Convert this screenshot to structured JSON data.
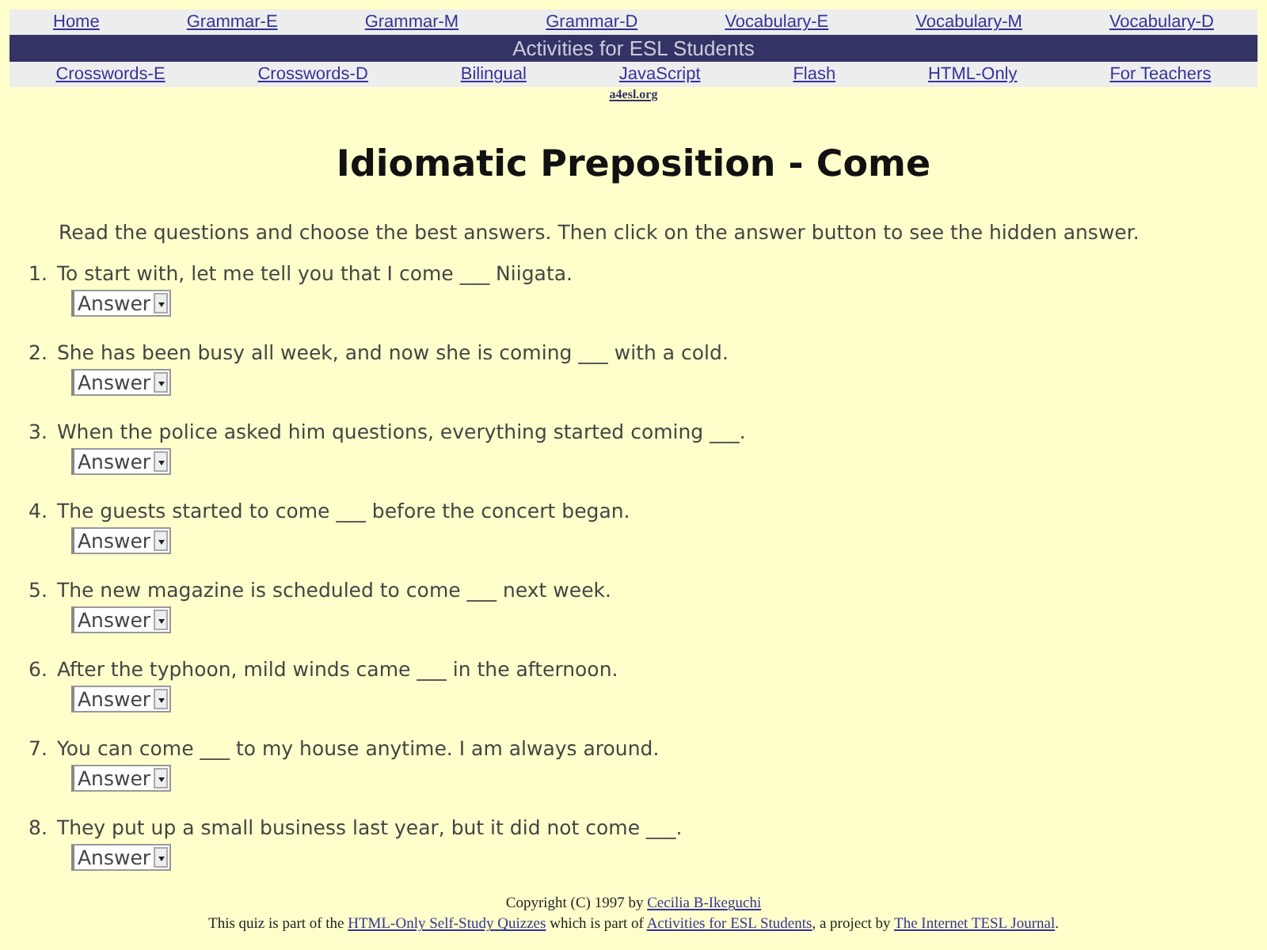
{
  "nav_top": [
    "Home",
    "Grammar-E",
    "Grammar-M",
    "Grammar-D",
    "Vocabulary-E",
    "Vocabulary-M",
    "Vocabulary-D"
  ],
  "banner": "Activities for ESL Students",
  "nav_bottom": [
    "Crosswords-E",
    "Crosswords-D",
    "Bilingual",
    "JavaScript",
    "Flash",
    "HTML-Only",
    "For Teachers"
  ],
  "site_link": "a4esl.org",
  "title": "Idiomatic Preposition - Come",
  "instructions": "Read the questions and choose the best answers. Then click on the answer button to see the hidden answer.",
  "questions": [
    {
      "number": "1.",
      "text": "To start with, let me tell you that I come ___ Niigata.",
      "answer": "Answer"
    },
    {
      "number": "2.",
      "text": "She has been busy all week, and now she is coming ___ with a cold.",
      "answer": "Answer"
    },
    {
      "number": "3.",
      "text": "When the police asked him questions, everything started coming ___.",
      "answer": "Answer"
    },
    {
      "number": "4.",
      "text": "The guests started to come ___ before the concert began.",
      "answer": "Answer"
    },
    {
      "number": "5.",
      "text": "The new magazine is scheduled to come ___ next week.",
      "answer": "Answer"
    },
    {
      "number": "6.",
      "text": "After the typhoon, mild winds came ___ in the afternoon.",
      "answer": "Answer"
    },
    {
      "number": "7.",
      "text": "You can come ___ to my house anytime. I am always around.",
      "answer": "Answer"
    },
    {
      "number": "8.",
      "text": "They put up a small business last year, but it did not come ___.",
      "answer": "Answer"
    }
  ],
  "footer": [
    [
      {
        "kind": "text",
        "text": "Copyright (C) 1997 by "
      },
      {
        "kind": "link",
        "text": "Cecilia B-Ikeguchi"
      }
    ],
    [
      {
        "kind": "text",
        "text": "This quiz is part of the "
      },
      {
        "kind": "link",
        "text": "HTML-Only Self-Study Quizzes"
      },
      {
        "kind": "text",
        "text": " which is part of "
      },
      {
        "kind": "link",
        "text": "Activities for ESL Students"
      },
      {
        "kind": "text",
        "text": ", a project by "
      },
      {
        "kind": "link",
        "text": "The Internet TESL Journal"
      },
      {
        "kind": "text",
        "text": "."
      }
    ]
  ]
}
